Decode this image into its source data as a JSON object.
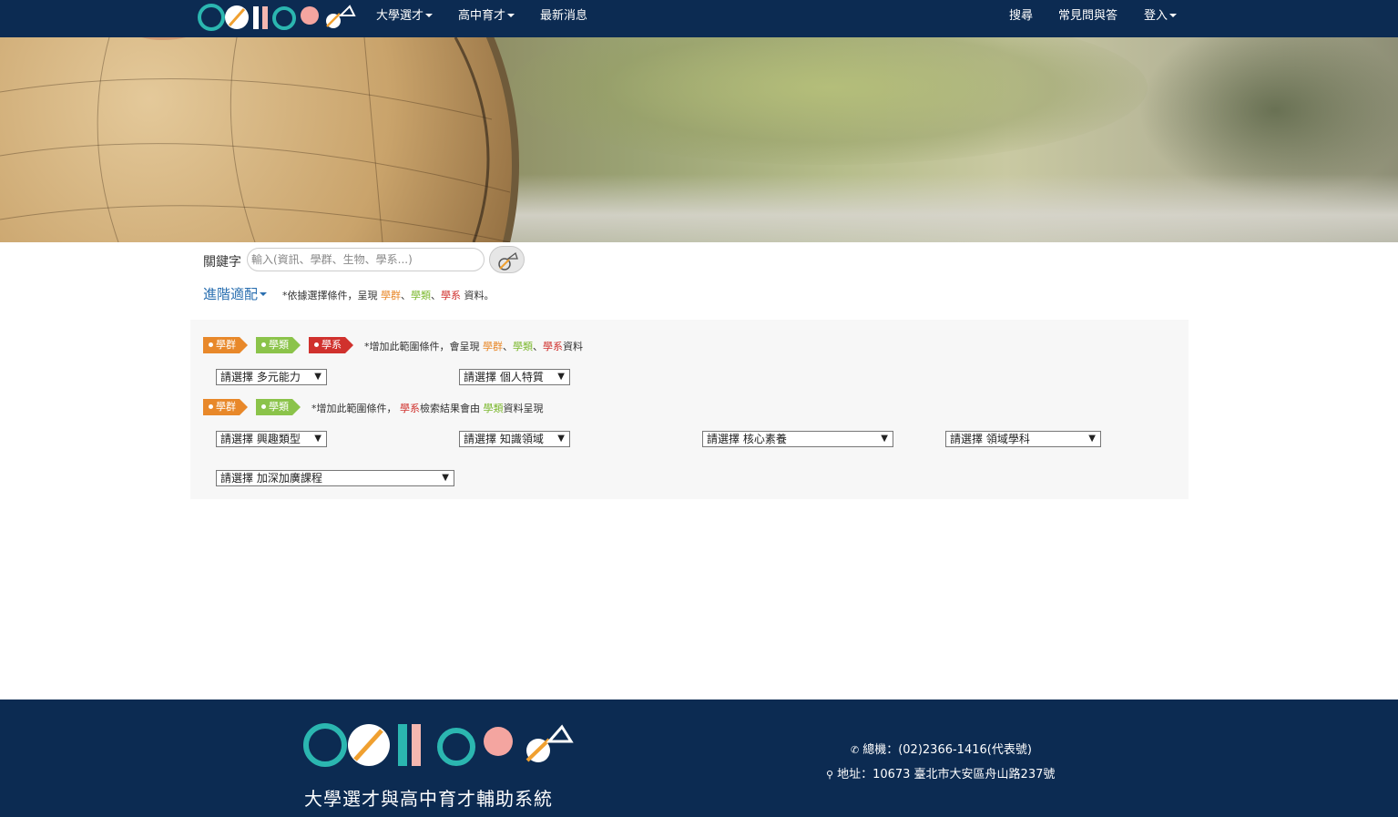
{
  "brand": {
    "logo_text": "colleg"
  },
  "nav": {
    "left": [
      {
        "label": "大學選才",
        "dropdown": true
      },
      {
        "label": "高中育才",
        "dropdown": true
      },
      {
        "label": "最新消息",
        "dropdown": false
      }
    ],
    "right": [
      {
        "label": "搜尋",
        "dropdown": false
      },
      {
        "label": "常見問與答",
        "dropdown": false
      },
      {
        "label": "登入",
        "dropdown": true
      }
    ]
  },
  "search": {
    "label": "關鍵字",
    "placeholder": "輸入(資訊、學群、生物、學系...)"
  },
  "advanced": {
    "link_label": "進階適配",
    "hint_prefix": "*依據選擇條件，呈現 ",
    "hint_group": "學群",
    "hint_sep1": "、",
    "hint_category": "學類",
    "hint_sep2": "、",
    "hint_dept": "學系",
    "hint_suffix": " 資料。"
  },
  "panel": {
    "row1": {
      "tags": [
        "學群",
        "學類",
        "學系"
      ],
      "note_prefix": "*增加此範圍條件，會呈現 ",
      "note_group": "學群",
      "note_sep1": "、",
      "note_category": "學類",
      "note_sep2": "、",
      "note_dept": "學系",
      "note_suffix": "資料"
    },
    "row2": {
      "tags": [
        "學群",
        "學類"
      ],
      "note_prefix": "*增加此範圍條件， ",
      "note_dept": "學系",
      "note_mid": "檢索結果會由 ",
      "note_category": "學類",
      "note_suffix": "資料呈現"
    },
    "selects": {
      "multi_ability": "請選擇 多元能力",
      "personal_traits": "請選擇 個人特質",
      "interest_type": "請選擇 興趣類型",
      "knowledge_domain": "請選擇 知識領域",
      "core_literacy": "請選擇 核心素養",
      "domain_subject": "請選擇 領域學科",
      "advanced_course": "請選擇 加深加廣課程"
    },
    "arrow": "▼"
  },
  "footer": {
    "tagline": "大學選才與高中育才輔助系統",
    "phone": "總機：(02)2366-1416(代表號)",
    "address": "地址：10673 臺北市大安區舟山路237號"
  },
  "colors": {
    "navy": "#0c2b52",
    "group_orange": "#e8882a",
    "category_green": "#8bc34a",
    "dept_red": "#d0312d",
    "link_blue": "#2a6fb0"
  }
}
